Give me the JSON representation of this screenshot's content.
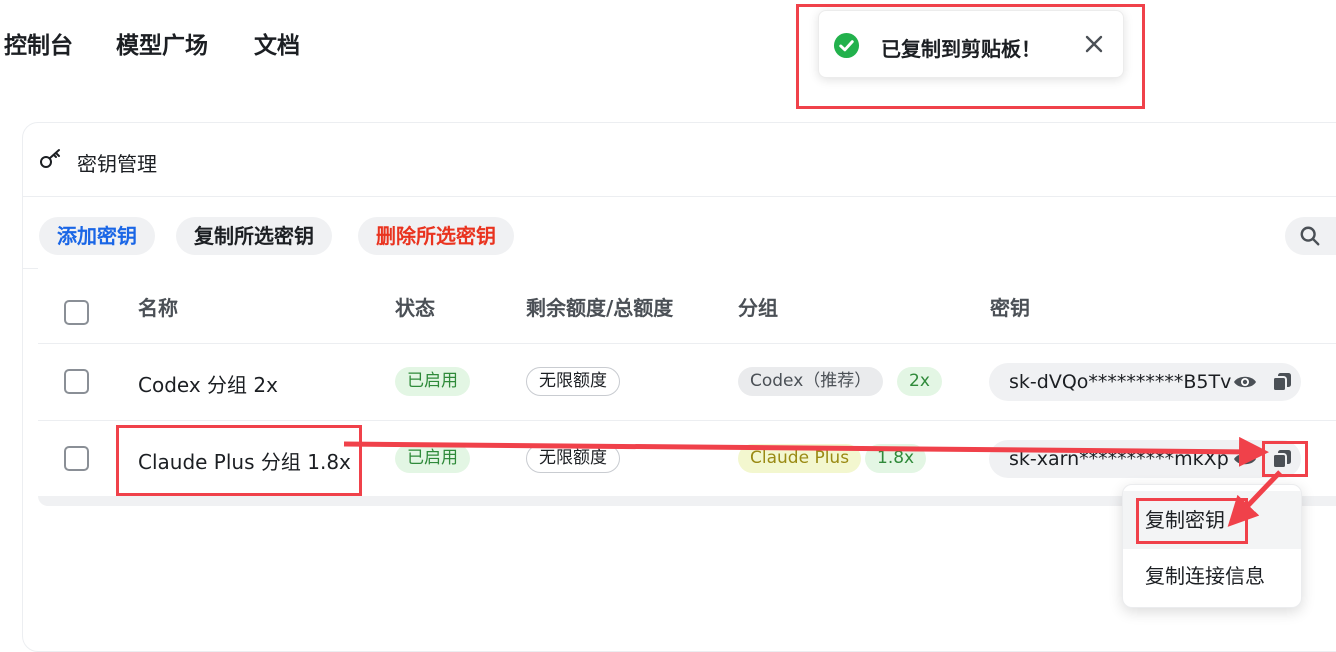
{
  "nav": {
    "items": [
      "控制台",
      "模型广场",
      "文档"
    ]
  },
  "toast": {
    "message": "已复制到剪贴板！",
    "icon": "check-circle-icon",
    "success_color": "#22b14c"
  },
  "card": {
    "title": "密钥管理",
    "icon": "key-icon"
  },
  "toolbar": {
    "add_label": "添加密钥",
    "add_color": "#1a66e6",
    "copy_selected_label": "复制所选密钥",
    "delete_selected_label": "删除所选密钥",
    "delete_color": "#e9331f",
    "search_icon": "search-icon"
  },
  "table": {
    "columns": [
      "名称",
      "状态",
      "剩余额度/总额度",
      "分组",
      "密钥"
    ],
    "rows": [
      {
        "name": "Codex 分组 2x",
        "status": "已启用",
        "quota": "无限额度",
        "group": "Codex（推荐）",
        "ratio": "2x",
        "key": "sk-dVQo**********B5Tv"
      },
      {
        "name": "Claude Plus 分组 1.8x",
        "status": "已启用",
        "quota": "无限额度",
        "group": "Claude Plus",
        "ratio": "1.8x",
        "key": "sk-xarn**********mkXp"
      }
    ]
  },
  "dropdown": {
    "items": [
      "复制密钥",
      "复制连接信息"
    ]
  },
  "annotation_color": "#f0414a"
}
